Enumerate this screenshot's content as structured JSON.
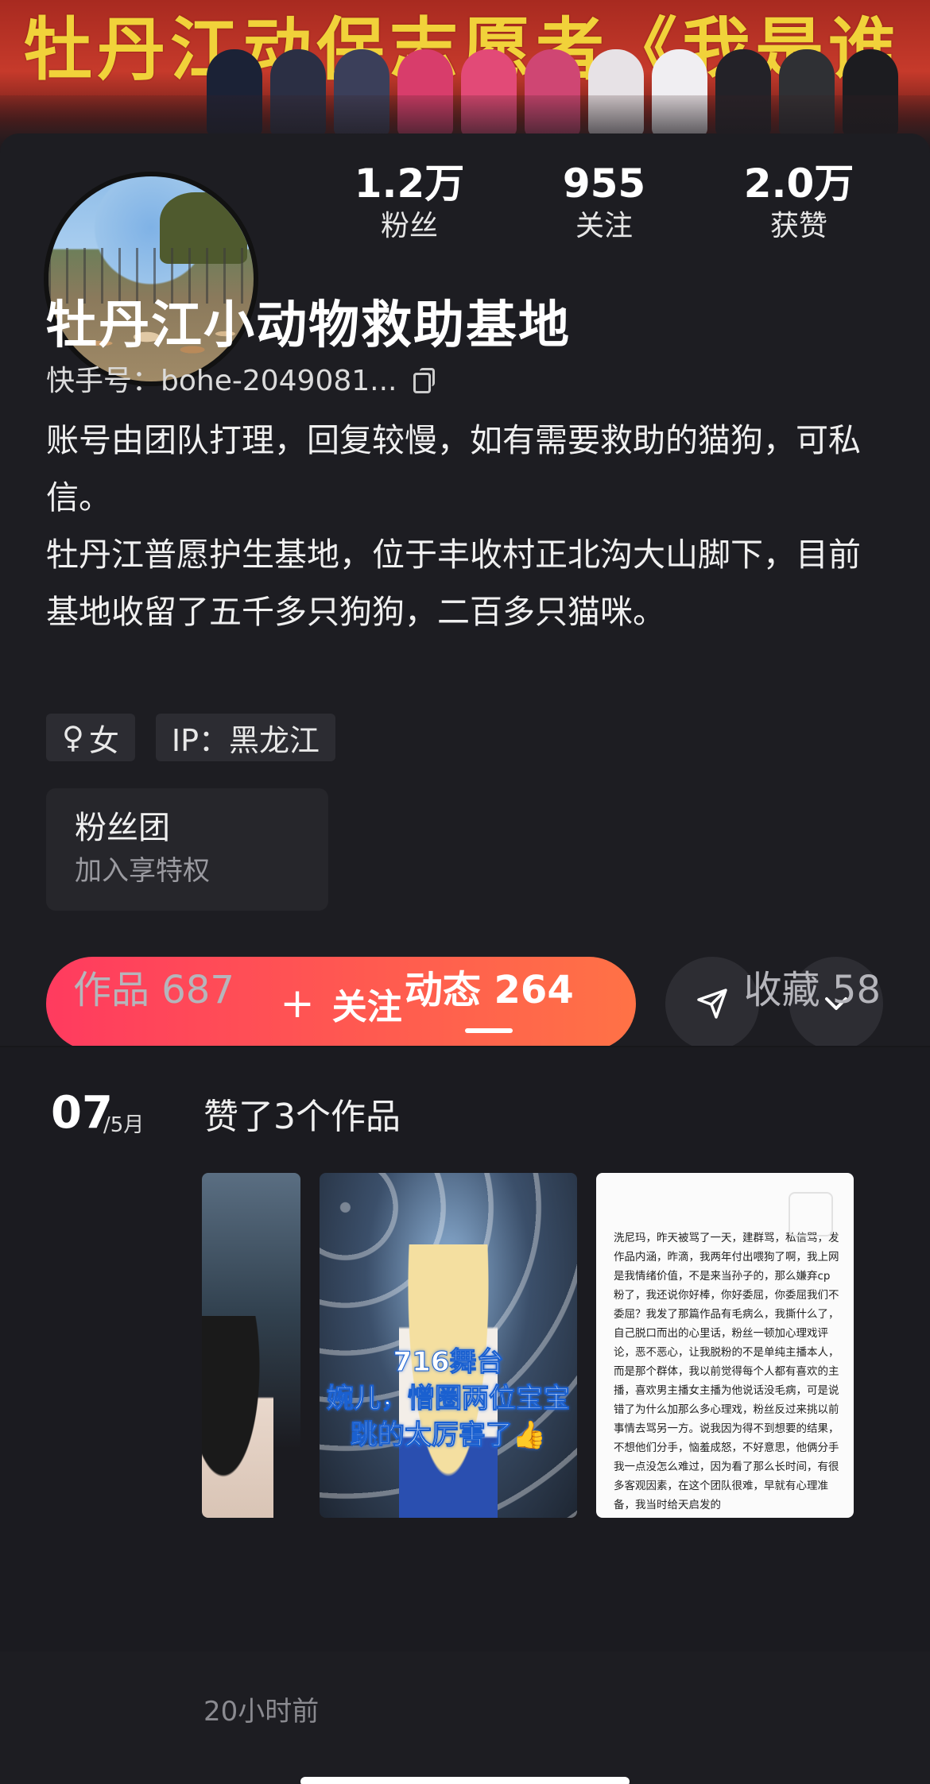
{
  "banner": {
    "text": "牡丹江动保志愿者《我是谁"
  },
  "profile": {
    "name": "牡丹江小动物救助基地",
    "kwai_id": "快手号：bohe-2049081...",
    "bio_lines": [
      "账号由团队打理，回复较慢，如有需要救助的猫狗，可私信。",
      "牡丹江普愿护生基地，位于丰收村正北沟大山脚下，目前基地收留了五千多只狗狗，二百多只猫咪。"
    ],
    "tags": {
      "gender_symbol": "♀",
      "gender": "女",
      "ip": "IP：黑龙江"
    }
  },
  "stats": [
    {
      "value": "1.2万",
      "label": "粉丝"
    },
    {
      "value": "955",
      "label": "关注"
    },
    {
      "value": "2.0万",
      "label": "获赞"
    }
  ],
  "fan_group": {
    "title": "粉丝团",
    "subtitle": "加入享特权"
  },
  "actions": {
    "follow_label": "关注",
    "plus": "+"
  },
  "tabs": [
    {
      "label": "作品 687",
      "active": false
    },
    {
      "label": "动态 264",
      "active": true
    },
    {
      "label": "收藏 58",
      "active": false
    }
  ],
  "feed": {
    "day": "07",
    "month": "/5月",
    "text": "赞了3个作品",
    "thumb2_captions": [
      "716舞台",
      "婉儿，憎圈两位宝宝",
      "跳的太厉害了👍"
    ],
    "thumb3_text": "洗尼玛，昨天被骂了一天，建群骂，私信骂，发作品内涵，昨滴，我两年付出喂狗了啊，我上网是我情绪价值，不是来当孙子的，那么嫌弃cp粉了，我还说你好棒，你好委屈，你委屈我们不委屈？我发了那篇作品有毛病么，我撕什么了，自己脱口而出的心里话，粉丝一顿加心理戏评论，恶不恶心，让我脱粉的不是单纯主播本人，而是那个群体，我以前觉得每个人都有喜欢的主播，喜欢男主播女主播为他说话没毛病，可是说错了为什么加那么多心理戏，粉丝反过来挑以前事情去骂另一方。说我因为得不到想要的结果，不想他们分手，恼羞成怒，不好意思，他俩分手我一点没怎么难过，因为看了那么长时间，有很多客观因素，在这个团队很难，早就有心理准备，我当时给天启发的",
    "timestamp": "20小时前"
  },
  "icons": {
    "copy": "copy-icon",
    "send": "send-icon",
    "more": "chevron-down-icon",
    "gender": "female-icon"
  },
  "colors": {
    "follow_gradient_start": "#ff3b5f",
    "follow_gradient_end": "#ff7246",
    "background": "#1d1d22"
  }
}
